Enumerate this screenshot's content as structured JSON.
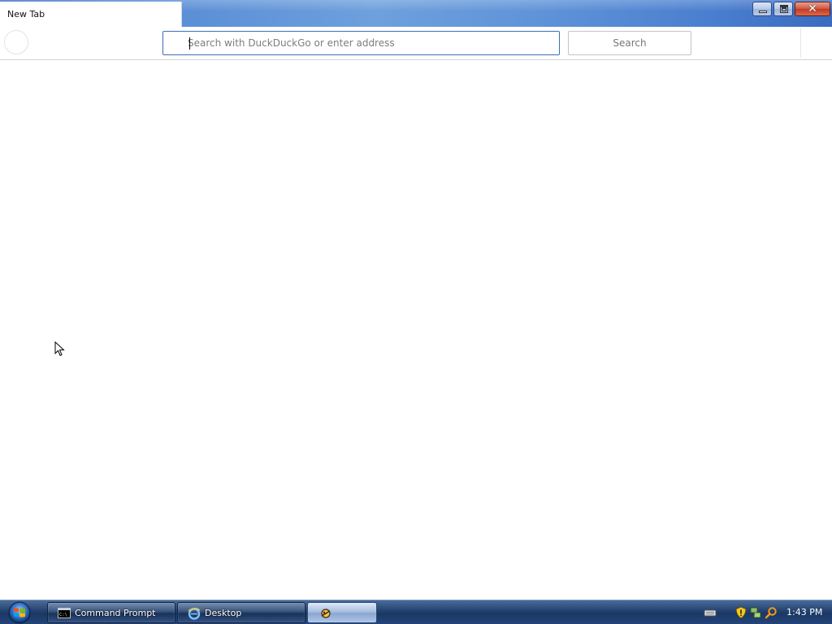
{
  "browser": {
    "tab": {
      "title": "New Tab"
    },
    "address_bar": {
      "placeholder": "Search with DuckDuckGo or enter address",
      "value": ""
    },
    "search_button_label": "Search",
    "window_controls": {
      "close_glyph": "✕"
    }
  },
  "taskbar": {
    "items": [
      {
        "label": "Command Prompt",
        "icon": "command-prompt-icon"
      },
      {
        "label": "Desktop",
        "icon": "internet-explorer-icon"
      },
      {
        "label": "",
        "icon": "app-icon",
        "active": true
      }
    ],
    "tray": {
      "icons": [
        "keyboard-icon",
        "security-shield-icon",
        "network-icon",
        "search-icon"
      ],
      "clock": "1:43 PM"
    }
  },
  "colors": {
    "titlebar": "#5b8fd6",
    "address_border": "#3c6fb5",
    "taskbar": "#1b3863",
    "close_button": "#c23a22"
  }
}
